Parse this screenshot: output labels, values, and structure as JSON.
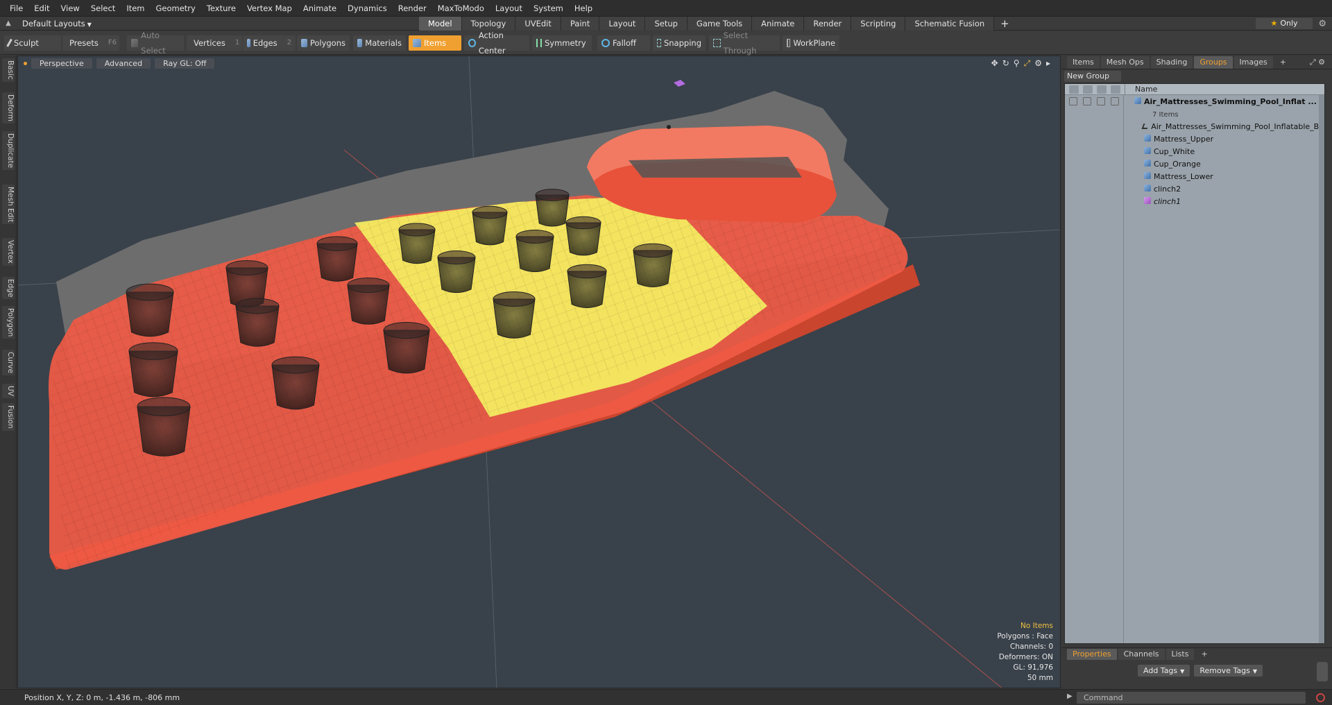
{
  "menu": [
    "File",
    "Edit",
    "View",
    "Select",
    "Item",
    "Geometry",
    "Texture",
    "Vertex Map",
    "Animate",
    "Dynamics",
    "Render",
    "MaxToModo",
    "Layout",
    "System",
    "Help"
  ],
  "layout_selector": "Default Layouts",
  "layout_tabs": [
    "Model",
    "Topology",
    "UVEdit",
    "Paint",
    "Layout",
    "Setup",
    "Game Tools",
    "Animate",
    "Render",
    "Scripting",
    "Schematic Fusion"
  ],
  "active_layout_tab": "Model",
  "only_button": "Only",
  "toolbar": {
    "sculpt": "Sculpt",
    "presets": "Presets",
    "presets_hotkey": "F6",
    "auto_select": "Auto Select",
    "vertices": "Vertices",
    "vertices_hotkey": "1",
    "edges": "Edges",
    "edges_hotkey": "2",
    "polygons": "Polygons",
    "materials": "Materials",
    "items": "Items",
    "action_center": "Action Center",
    "symmetry": "Symmetry",
    "falloff": "Falloff",
    "snapping": "Snapping",
    "select_through": "Select Through",
    "workplane": "WorkPlane"
  },
  "left_tabs": [
    "Basic",
    "Deform",
    "Duplicate",
    "Mesh Edit",
    "Vertex",
    "Edge",
    "Polygon",
    "Curve",
    "UV",
    "Fusion"
  ],
  "viewport": {
    "view": "Perspective",
    "shading": "Advanced",
    "raygl": "Ray GL: Off",
    "info": {
      "items": "No Items",
      "polygons": "Polygons : Face",
      "channels": "Channels: 0",
      "deformers": "Deformers: ON",
      "gl": "GL: 91,976",
      "scale": "50 mm"
    }
  },
  "right_panel": {
    "tabs": [
      "Items",
      "Mesh Ops",
      "Shading",
      "Groups",
      "Images"
    ],
    "active_tab": "Groups",
    "new_group": "New Group",
    "column_name": "Name",
    "tree": [
      {
        "label": "Air_Mattresses_Swimming_Pool_Inflat ...",
        "type": "group",
        "root": true
      },
      {
        "label": "7 Items",
        "type": "count"
      },
      {
        "label": "Air_Mattresses_Swimming_Pool_Inflatable_Bed",
        "type": "locator"
      },
      {
        "label": "Mattress_Upper",
        "type": "mesh"
      },
      {
        "label": "Cup_White",
        "type": "mesh"
      },
      {
        "label": "Cup_Orange",
        "type": "mesh"
      },
      {
        "label": "Mattress_Lower",
        "type": "mesh"
      },
      {
        "label": "clinch2",
        "type": "mesh"
      },
      {
        "label": "clinch1",
        "type": "deformer"
      }
    ],
    "bottom_tabs": [
      "Properties",
      "Channels",
      "Lists"
    ],
    "active_bottom_tab": "Properties",
    "add_tags": "Add Tags",
    "remove_tags": "Remove Tags"
  },
  "status": {
    "position": "Position X, Y, Z:  0 m, -1.436 m, -806 mm",
    "command_placeholder": "Command"
  },
  "colors": {
    "accent": "#f0a030",
    "mattress_red": "#f15b45",
    "mattress_yellow": "#f4ef62",
    "viewport_bg": "#39414a"
  }
}
